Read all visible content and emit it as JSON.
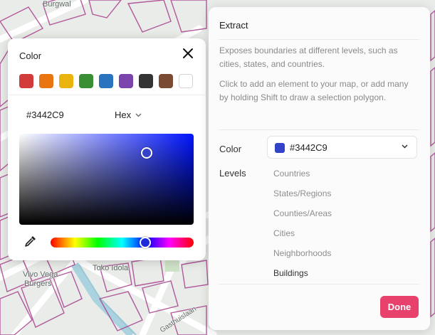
{
  "map": {
    "labels": [
      "Burgwal",
      "Vivo Vega",
      "Burgers",
      "Toko Idola",
      "Gasthuislaan"
    ]
  },
  "picker": {
    "title": "Color",
    "swatches": [
      {
        "name": "red",
        "color": "#d33a3a"
      },
      {
        "name": "orange",
        "color": "#e8750f"
      },
      {
        "name": "yellow",
        "color": "#e9b40e"
      },
      {
        "name": "green",
        "color": "#3a8f34"
      },
      {
        "name": "blue",
        "color": "#2a74bf"
      },
      {
        "name": "purple",
        "color": "#7b44ad"
      },
      {
        "name": "dark-gray",
        "color": "#343434"
      },
      {
        "name": "brown",
        "color": "#7a4a33"
      },
      {
        "name": "white",
        "color": "#ffffff"
      }
    ],
    "hex_value": "#3442C9",
    "format": "Hex",
    "current_color": "#3442C9",
    "hue_base_color": "#0015ff",
    "saturation_pct": 73,
    "value_pct": 79,
    "hue_pct": 66
  },
  "panel": {
    "title": "Extract",
    "description": "Exposes boundaries at different levels, such as cities, states, and countries.",
    "instructions": "Click to add an element to your map, or add many by holding Shift to draw a selection polygon.",
    "color_label": "Color",
    "color_value": "#3442C9",
    "levels_label": "Levels",
    "levels": [
      "Countries",
      "States/Regions",
      "Counties/Areas",
      "Cities",
      "Neighborhoods",
      "Buildings"
    ],
    "active_level": "Buildings",
    "done_label": "Done",
    "accent_color": "#e8416b"
  }
}
